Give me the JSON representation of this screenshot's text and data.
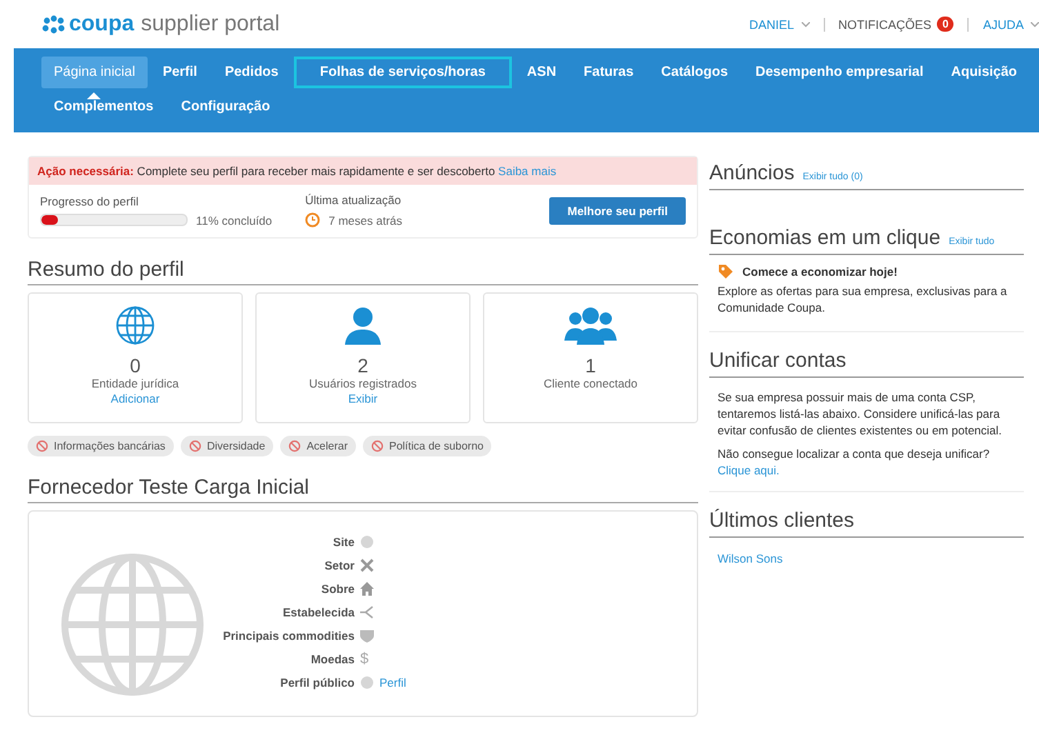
{
  "header": {
    "logo_brand": "coupa",
    "logo_product": "supplier portal",
    "user": "DANIEL",
    "notifications_label": "NOTIFICAÇÕES",
    "notifications_count": "0",
    "help": "AJUDA"
  },
  "nav": {
    "rows": [
      [
        {
          "label": "Página inicial",
          "selected": true,
          "highlighted": false
        },
        {
          "label": "Perfil",
          "selected": false,
          "highlighted": false
        },
        {
          "label": "Pedidos",
          "selected": false,
          "highlighted": false
        },
        {
          "label": "Folhas de serviços/horas",
          "selected": false,
          "highlighted": true
        },
        {
          "label": "ASN",
          "selected": false,
          "highlighted": false
        },
        {
          "label": "Faturas",
          "selected": false,
          "highlighted": false
        },
        {
          "label": "Catálogos",
          "selected": false,
          "highlighted": false
        },
        {
          "label": "Desempenho empresarial",
          "selected": false,
          "highlighted": false
        },
        {
          "label": "Aquisição",
          "selected": false,
          "highlighted": false
        }
      ],
      [
        {
          "label": "Complementos",
          "selected": false,
          "highlighted": false
        },
        {
          "label": "Configuração",
          "selected": false,
          "highlighted": false
        }
      ]
    ]
  },
  "alert": {
    "label": "Ação necessária:",
    "message": "Complete seu perfil para receber mais rapidamente e ser descoberto",
    "link": "Saiba mais"
  },
  "progress": {
    "label": "Progresso do perfil",
    "level": 0.11,
    "reading": "11% concluído",
    "updated_label": "Última atualização",
    "updated_value": "7 meses atrás",
    "button": "Melhore seu perfil"
  },
  "summary": {
    "title": "Resumo do perfil",
    "cards": [
      {
        "kind": "globe",
        "count": "0",
        "label": "Entidade jurídica",
        "link": "Adicionar"
      },
      {
        "kind": "user",
        "count": "2",
        "label": "Usuários registrados",
        "link": "Exibir"
      },
      {
        "kind": "users",
        "count": "1",
        "label": "Cliente conectado"
      }
    ],
    "chips": [
      "Informações bancárias",
      "Diversidade",
      "Acelerar",
      "Política de suborno"
    ]
  },
  "supplier": {
    "title": "Fornecedor Teste Carga Inicial",
    "fields": [
      {
        "label": "Site",
        "kind": "dot"
      },
      {
        "label": "Setor",
        "kind": "tools"
      },
      {
        "label": "Sobre",
        "kind": "home"
      },
      {
        "label": "Estabelecida",
        "kind": "branch"
      },
      {
        "label": "Principais commodities",
        "kind": "shield"
      },
      {
        "label": "Moedas",
        "kind": "dollar",
        "symbol": "$"
      },
      {
        "label": "Perfil público",
        "kind": "dot",
        "link": "Perfil"
      }
    ]
  },
  "sidebar": {
    "announcements": {
      "title": "Anúncios",
      "link": "Exibir tudo (0)"
    },
    "savings": {
      "title": "Economias em um clique",
      "link": "Exibir tudo",
      "headline": "Comece a economizar hoje!",
      "text": "Explore as ofertas para sua empresa, exclusivas para a Comunidade Coupa."
    },
    "unify": {
      "title": "Unificar contas",
      "text": "Se sua empresa possuir mais de uma conta CSP, tentaremos listá-las abaixo. Considere unificá-las para evitar confusão de clientes existentes ou em potencial.",
      "question": "Não consegue localizar a conta que deseja unificar?",
      "link": "Clique aqui."
    },
    "clients": {
      "title": "Últimos clientes",
      "items": [
        "Wilson Sons"
      ]
    }
  }
}
